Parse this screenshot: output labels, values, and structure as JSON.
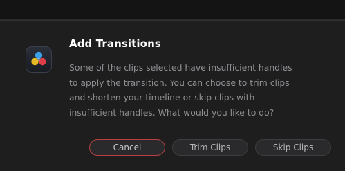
{
  "dialog": {
    "title": "Add Transitions",
    "message": "Some of the clips selected have insufficient handles to apply the transition. You can choose to trim clips and shorten your timeline or skip clips with insufficient handles. What would you like to do?",
    "icon": "davinci-resolve-icon"
  },
  "buttons": {
    "cancel_label": "Cancel",
    "trim_label": "Trim Clips",
    "skip_label": "Skip Clips"
  },
  "colors": {
    "cancel_border": "#b84040",
    "background": "#1e1e1f"
  }
}
